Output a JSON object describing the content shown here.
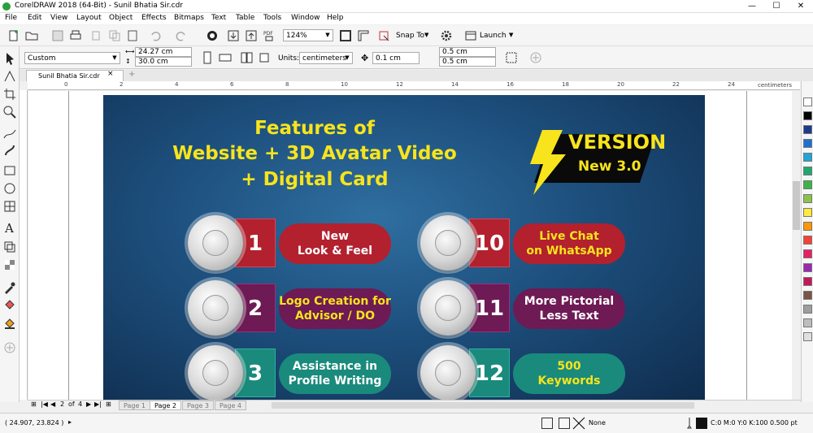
{
  "window": {
    "title": "CorelDRAW 2018 (64-Bit) - Sunil Bhatia Sir.cdr",
    "minimize": "—",
    "maximize": "☐",
    "close": "✕"
  },
  "menu": [
    "File",
    "Edit",
    "View",
    "Layout",
    "Object",
    "Effects",
    "Bitmaps",
    "Text",
    "Table",
    "Tools",
    "Window",
    "Help"
  ],
  "toolbar": {
    "zoom": "124%",
    "snap_to": "Snap To",
    "launch": "Launch"
  },
  "propbar": {
    "page_preset": "Custom",
    "width": "24.27 cm",
    "height": "30.0 cm",
    "units_label": "Units:",
    "units": "centimeters",
    "nudge": "0.1 cm",
    "dup_x": "0.5 cm",
    "dup_y": "0.5 cm"
  },
  "document_tab": "Sunil Bhatia Sir.cdr",
  "ruler": {
    "h_numbers": [
      "0",
      "2",
      "4",
      "6",
      "8",
      "10",
      "12",
      "14",
      "16",
      "18",
      "20",
      "22",
      "24"
    ],
    "h_unit": "centimeters"
  },
  "artwork": {
    "headline": [
      "Features of",
      "Website + 3D Avatar Video",
      "+ Digital Card"
    ],
    "version_title": "VERSION",
    "version_sub": "New 3.0",
    "features": [
      {
        "num": "1",
        "text1": "New",
        "text2": "Look & Feel",
        "color": "#b3202e"
      },
      {
        "num": "2",
        "text1": "Logo Creation for",
        "text2": "Advisor / DO",
        "color": "#6e1a55"
      },
      {
        "num": "3",
        "text1": "Assistance in",
        "text2": "Profile Writing",
        "color": "#1a8a7c"
      },
      {
        "num": "10",
        "text1": "Live Chat",
        "text2": "on WhatsApp",
        "color": "#b3202e"
      },
      {
        "num": "11",
        "text1": "More Pictorial",
        "text2": "Less Text",
        "color": "#6e1a55"
      },
      {
        "num": "12",
        "text1": "500",
        "text2": "Keywords",
        "color": "#1a8a7c"
      }
    ],
    "colors": {
      "yellow": "#f7e41c",
      "red": "#b3202e",
      "purple": "#6e1a55",
      "teal": "#1a8a7c"
    }
  },
  "page_nav": {
    "current": "2",
    "of_label": "of",
    "total": "4",
    "pages": [
      "Page 1",
      "Page 2",
      "Page 3",
      "Page 4"
    ]
  },
  "status": {
    "coords": "( 24.907, 23.824 )",
    "fill": "None",
    "outline": "C:0 M:0 Y:0 K:100  0.500 pt"
  },
  "palette": [
    "#ffffff",
    "#000000",
    "#1e3a8a",
    "#1f6fd1",
    "#21a5d8",
    "#21a870",
    "#3cb44b",
    "#8bc34a",
    "#ffeb3b",
    "#ff9800",
    "#f44336",
    "#e91e63",
    "#9c27b0",
    "#c2185b",
    "#795548",
    "#9e9e9e",
    "#bdbdbd",
    "#e0e0e0"
  ]
}
